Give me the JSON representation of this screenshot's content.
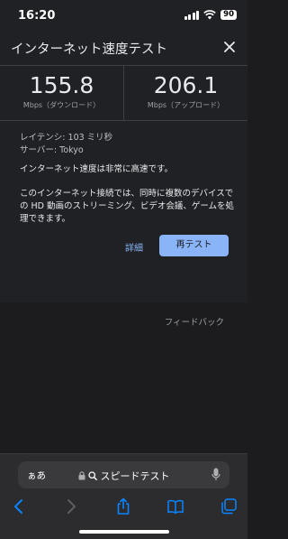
{
  "status_bar": {
    "time": "16:20",
    "battery": "90"
  },
  "panel": {
    "title": "インターネット速度テスト",
    "download": {
      "value": "155.8",
      "unit": "Mbps（ダウンロード）"
    },
    "upload": {
      "value": "206.1",
      "unit": "Mbps（アップロード）"
    },
    "latency": "レイテンシ: 103 ミリ秒",
    "server": "サーバー: Tokyo",
    "verdict": "インターネット速度は非常に高速です。",
    "description": "このインターネット接続では、同時に複数のデバイスでの HD 動画のストリーミング、ビデオ会議、ゲームを処理できます。",
    "details_label": "詳細",
    "retest_label": "再テスト",
    "feedback_label": "フィードバック"
  },
  "browser": {
    "aa_label": "ぁあ",
    "address": "スピードテスト"
  },
  "colors": {
    "accent": "#8ab4f8",
    "background": "#202124"
  }
}
